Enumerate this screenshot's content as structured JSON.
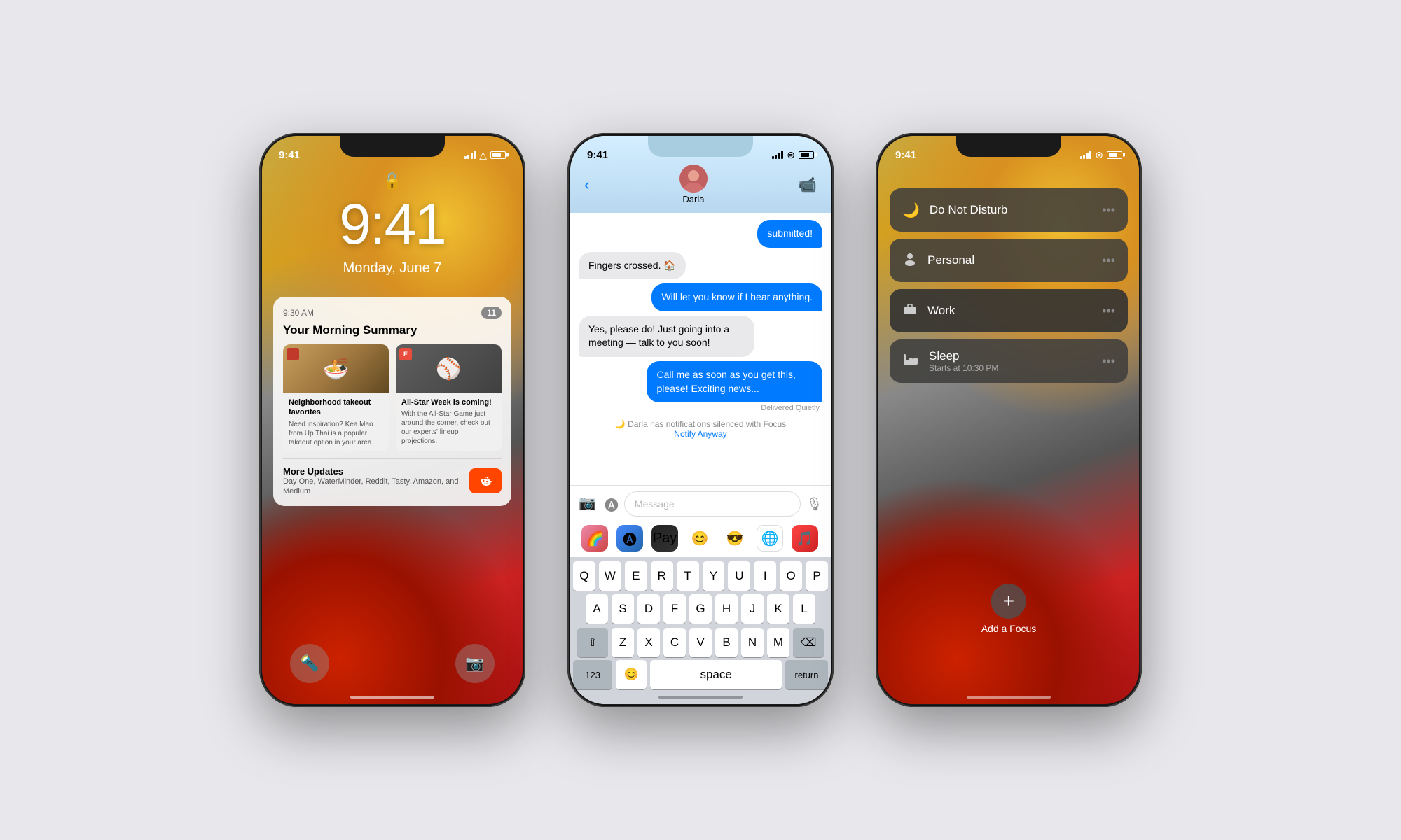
{
  "background": "#e8e8ec",
  "phone1": {
    "time": "9:41",
    "date": "Monday, June 7",
    "status_time": "9:41",
    "notification": {
      "time": "9:30 AM",
      "badge": "11",
      "title": "Your Morning Summary",
      "article1": {
        "headline": "Neighborhood takeout favorites",
        "desc": "Need inspiration? Kea Mao from Up Thai is a popular takeout option in your area."
      },
      "article2": {
        "headline": "All-Star Week is coming!",
        "desc": "With the All-Star Game just around the corner, check out our experts' lineup projections."
      },
      "more_title": "More Updates",
      "more_desc": "Day One, WaterMinder, Reddit, Tasty, Amazon, and Medium"
    }
  },
  "phone2": {
    "status_time": "9:41",
    "contact_name": "Darla",
    "messages": [
      {
        "type": "out",
        "text": "submitted!"
      },
      {
        "type": "in",
        "text": "Fingers crossed. 🏠"
      },
      {
        "type": "out",
        "text": "Will let you know if I hear anything."
      },
      {
        "type": "in",
        "text": "Yes, please do! Just going into a meeting — talk to you soon!"
      },
      {
        "type": "out",
        "text": "Call me as soon as you get this, please! Exciting news..."
      },
      {
        "type": "delivered",
        "text": "Delivered Quietly"
      },
      {
        "type": "focus",
        "text": "Darla has notifications silenced with Focus"
      },
      {
        "type": "notify",
        "text": "Notify Anyway"
      }
    ],
    "input_placeholder": "Message",
    "keyboard_rows": [
      [
        "Q",
        "W",
        "E",
        "R",
        "T",
        "Y",
        "U",
        "I",
        "O",
        "P"
      ],
      [
        "A",
        "S",
        "D",
        "F",
        "G",
        "H",
        "J",
        "K",
        "L"
      ],
      [
        "Z",
        "X",
        "C",
        "V",
        "B",
        "N",
        "M"
      ]
    ],
    "key_123": "123",
    "key_space": "space",
    "key_return": "return"
  },
  "phone3": {
    "status_time": "9:41",
    "focus_modes": [
      {
        "icon": "🌙",
        "label": "Do Not Disturb",
        "sublabel": ""
      },
      {
        "icon": "👤",
        "label": "Personal",
        "sublabel": ""
      },
      {
        "icon": "💼",
        "label": "Work",
        "sublabel": ""
      },
      {
        "icon": "🛏",
        "label": "Sleep",
        "sublabel": "Starts at 10:30 PM"
      }
    ],
    "add_label": "Add a Focus"
  }
}
